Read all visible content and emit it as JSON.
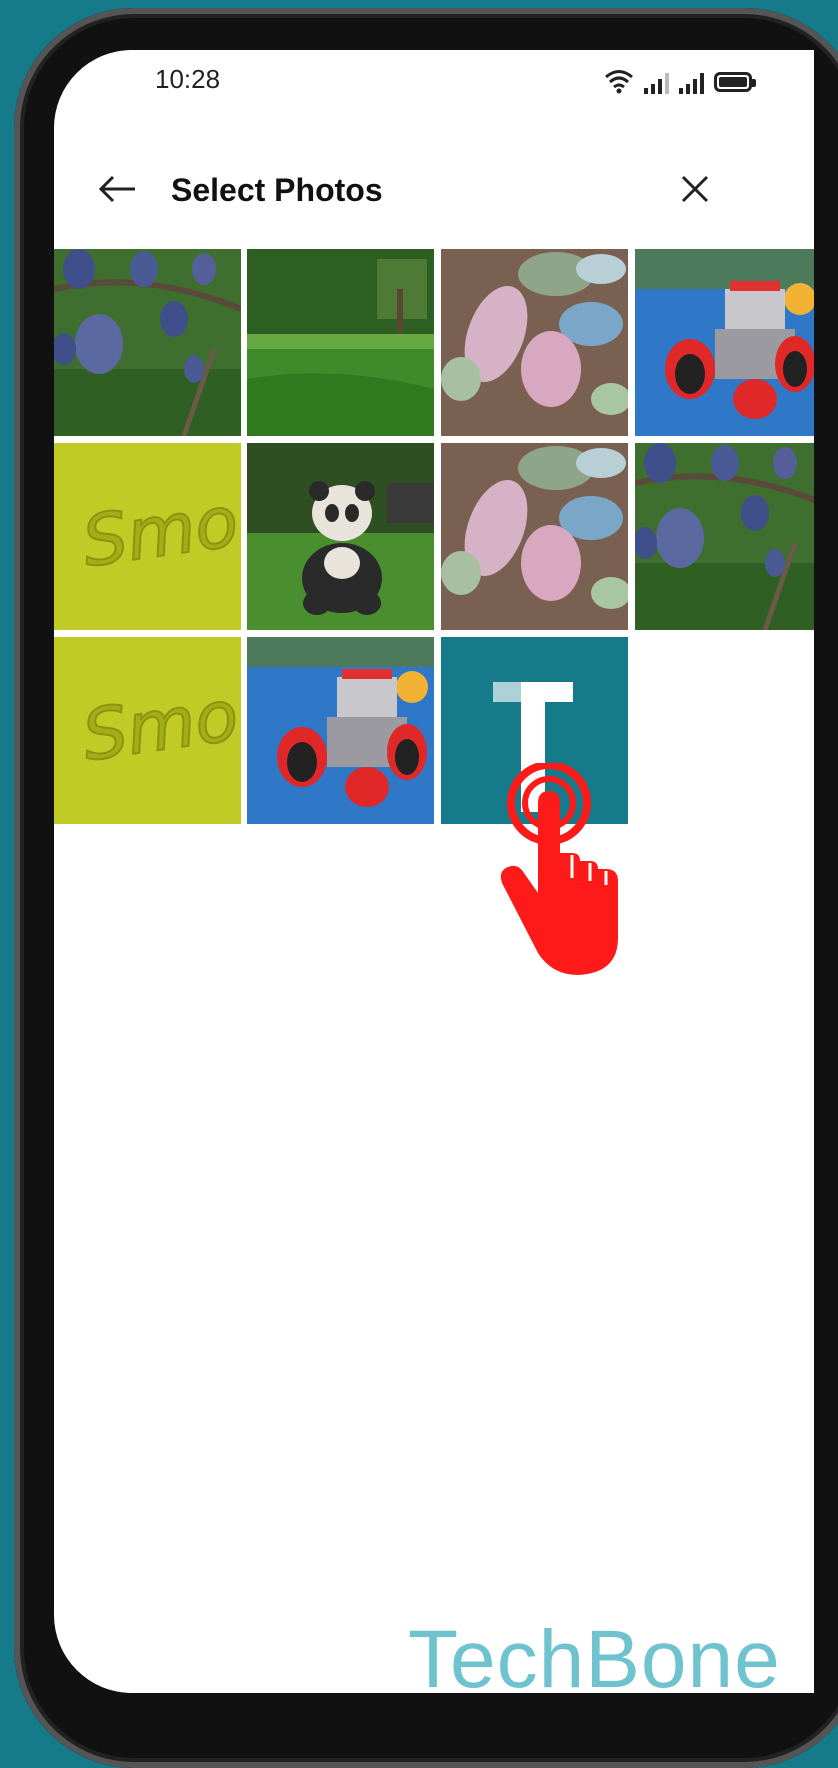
{
  "status_bar": {
    "time": "10:28",
    "icons": [
      "wifi-icon",
      "signal-icon",
      "signal-icon",
      "battery-icon"
    ]
  },
  "app_bar": {
    "title": "Select Photos",
    "back_icon": "arrow-left-icon",
    "close_icon": "close-icon"
  },
  "photos": [
    {
      "subject": "plums-on-branch"
    },
    {
      "subject": "green-lawn"
    },
    {
      "subject": "chalk-stones"
    },
    {
      "subject": "toy-car"
    },
    {
      "subject": "smoby-plastic",
      "text": "Smoby"
    },
    {
      "subject": "panda-toy"
    },
    {
      "subject": "chalk-stones"
    },
    {
      "subject": "plums-on-branch"
    },
    {
      "subject": "smoby-plastic",
      "text": "Smoby"
    },
    {
      "subject": "toy-car"
    },
    {
      "subject": "techbone-logo",
      "text": "T"
    }
  ],
  "watermark": "TechBone",
  "colors": {
    "background": "#157a8a",
    "logo_tile": "#157a8a",
    "hand": "#ff1a1a",
    "watermark": "#6fc3cf"
  }
}
